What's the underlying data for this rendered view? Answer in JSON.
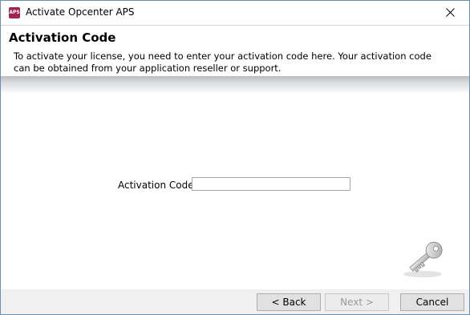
{
  "window": {
    "title": "Activate Opcenter APS",
    "icon_text": "APS",
    "icon_color": "#a3224f"
  },
  "header": {
    "title": "Activation Code",
    "description": "To activate your license, you need to enter your activation code here. Your activation code can be obtained from your application reseller or support."
  },
  "form": {
    "activation_code_label": "Activation Code:",
    "activation_code_value": ""
  },
  "buttons": {
    "back": "< Back",
    "next": "Next >",
    "next_enabled": false,
    "cancel": "Cancel"
  },
  "icons": {
    "close": "close-icon",
    "key": "key-icon"
  }
}
